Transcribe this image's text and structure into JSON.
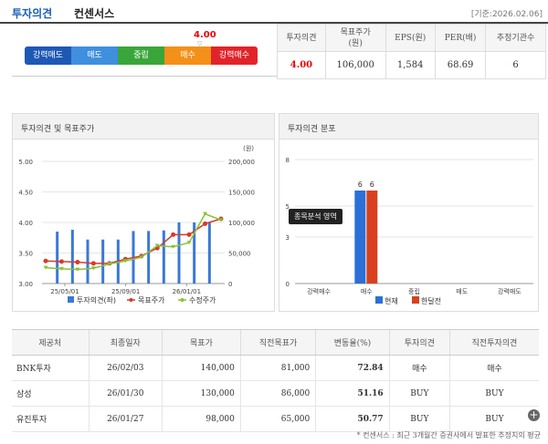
{
  "header": {
    "title_blue": "투자의견",
    "title_black": "컨센서스",
    "date": "[기준:2026.02.06]"
  },
  "opinion": {
    "value": "4.00",
    "marker": "▽",
    "scale": [
      "강력매도",
      "매도",
      "중립",
      "매수",
      "강력매수"
    ]
  },
  "summary": {
    "headers": [
      "투자의견",
      "목표주가\n(원)",
      "EPS(원)",
      "PER(배)",
      "추정기관수"
    ],
    "values": [
      "4.00",
      "106,000",
      "1,584",
      "68.69",
      "6"
    ]
  },
  "panel1": {
    "title": "투자의견 및 목표주가",
    "unit": "(원)"
  },
  "panel2": {
    "title": "투자의견 분포",
    "tooltip": "종목분석 영역"
  },
  "chart_data": [
    {
      "type": "bar+line",
      "title": "투자의견 및 목표주가",
      "x_ticks": [
        "25/05/01",
        "25/09/01",
        "26/01/01"
      ],
      "y_left": {
        "range": [
          3.0,
          5.0
        ],
        "ticks": [
          "5.00",
          "4.50",
          "4.00",
          "3.50",
          "3.00"
        ]
      },
      "y_right": {
        "range": [
          0,
          200000
        ],
        "ticks": [
          "200,000",
          "150,000",
          "100,000",
          "50,000",
          "0"
        ],
        "unit": "(원)"
      },
      "bars": [
        3.85,
        3.88,
        3.72,
        3.72,
        3.72,
        3.86,
        3.86,
        3.87,
        4.0,
        4.0,
        4.0
      ],
      "series": [
        {
          "name": "투자의견(좌)",
          "color": "#3a78d8",
          "kind": "bar"
        },
        {
          "name": "목표주가",
          "color": "#d83a26",
          "values": [
            37000,
            36000,
            35000,
            33000,
            33000,
            40000,
            45000,
            58000,
            80000,
            80000,
            98000,
            106000
          ]
        },
        {
          "name": "수정주가",
          "color": "#88c23a",
          "values": [
            26000,
            24000,
            23000,
            25000,
            32000,
            37000,
            43000,
            62000,
            60000,
            67000,
            114000,
            104000
          ]
        }
      ]
    },
    {
      "type": "bar",
      "title": "투자의견 분포",
      "categories": [
        "강력매수",
        "매수",
        "중립",
        "매도",
        "강력매도"
      ],
      "ylim": [
        0,
        8
      ],
      "y_ticks": [
        "8",
        "5",
        "3",
        "0"
      ],
      "series": [
        {
          "name": "현재",
          "color": "#2c6fd6",
          "values": [
            0,
            6,
            0,
            0,
            0
          ]
        },
        {
          "name": "한달전",
          "color": "#d8411f",
          "values": [
            0,
            6,
            0,
            0,
            0
          ]
        }
      ]
    }
  ],
  "consensus_table": {
    "headers": [
      "제공처",
      "최종일자",
      "목표가",
      "직전목표가",
      "변동율(%)",
      "투자의견",
      "직전투자의견"
    ],
    "rows": [
      [
        "BNK투자",
        "26/02/03",
        "140,000",
        "81,000",
        "72.84",
        "매수",
        "매수"
      ],
      [
        "삼성",
        "26/01/30",
        "130,000",
        "86,000",
        "51.16",
        "BUY",
        "BUY"
      ],
      [
        "유진투자",
        "26/01/27",
        "98,000",
        "65,000",
        "50.77",
        "BUY",
        "BUY"
      ]
    ]
  },
  "footnote": "* 컨센서스 : 최근 3개월간 증권사에서 발표한 추정치의 평균"
}
